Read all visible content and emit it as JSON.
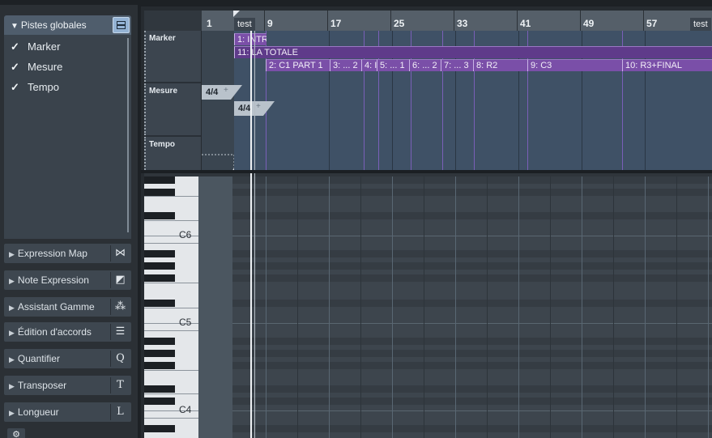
{
  "inspector": {
    "global_tracks": {
      "title": "Pistes globales",
      "items": [
        {
          "label": "Marker",
          "checked": true
        },
        {
          "label": "Mesure",
          "checked": true
        },
        {
          "label": "Tempo",
          "checked": true
        }
      ]
    },
    "sections": [
      {
        "label": "Expression Map",
        "icon": "bowtie-icon",
        "glyph": "⋈"
      },
      {
        "label": "Note Expression",
        "icon": "note-expression-icon",
        "glyph": "◩"
      },
      {
        "label": "Assistant Gamme",
        "icon": "scale-assistant-icon",
        "glyph": "⁂"
      },
      {
        "label": "Édition d'accords",
        "icon": "chord-edit-icon",
        "glyph": "☰"
      },
      {
        "label": "Quantifier",
        "icon": "quantize-icon",
        "glyph": "Q"
      },
      {
        "label": "Transposer",
        "icon": "transpose-icon",
        "glyph": "T"
      },
      {
        "label": "Longueur",
        "icon": "length-icon",
        "glyph": "L"
      }
    ],
    "gear_glyph": "⚙"
  },
  "ruler": {
    "bars": [
      "1",
      "9",
      "17",
      "25",
      "33",
      "41",
      "49",
      "57"
    ],
    "test_chip_left": "test",
    "test_chip_right": "test"
  },
  "tracks": {
    "marker": {
      "name": "Marker",
      "row1": [
        "1: INTR"
      ],
      "row2": [
        "11: LA TOTALE"
      ],
      "row3": [
        "2: C1 PART 1",
        "3: ... 2",
        "4: I",
        "5: ... 1",
        "6: ... 2",
        "7: ... 3",
        "8: R2",
        "9: C3",
        "10: R3+FINAL"
      ]
    },
    "signature": {
      "name": "Mesure",
      "events": [
        "4/4",
        "4/4"
      ]
    },
    "tempo": {
      "name": "Tempo"
    }
  },
  "piano": {
    "labels": [
      "C6",
      "C5",
      "C4"
    ]
  },
  "colors": {
    "marker": "#7a4fa8",
    "track_bg": "#3f5166",
    "inspector_bg": "#2b3035",
    "accent_button": "#94b3d4"
  }
}
